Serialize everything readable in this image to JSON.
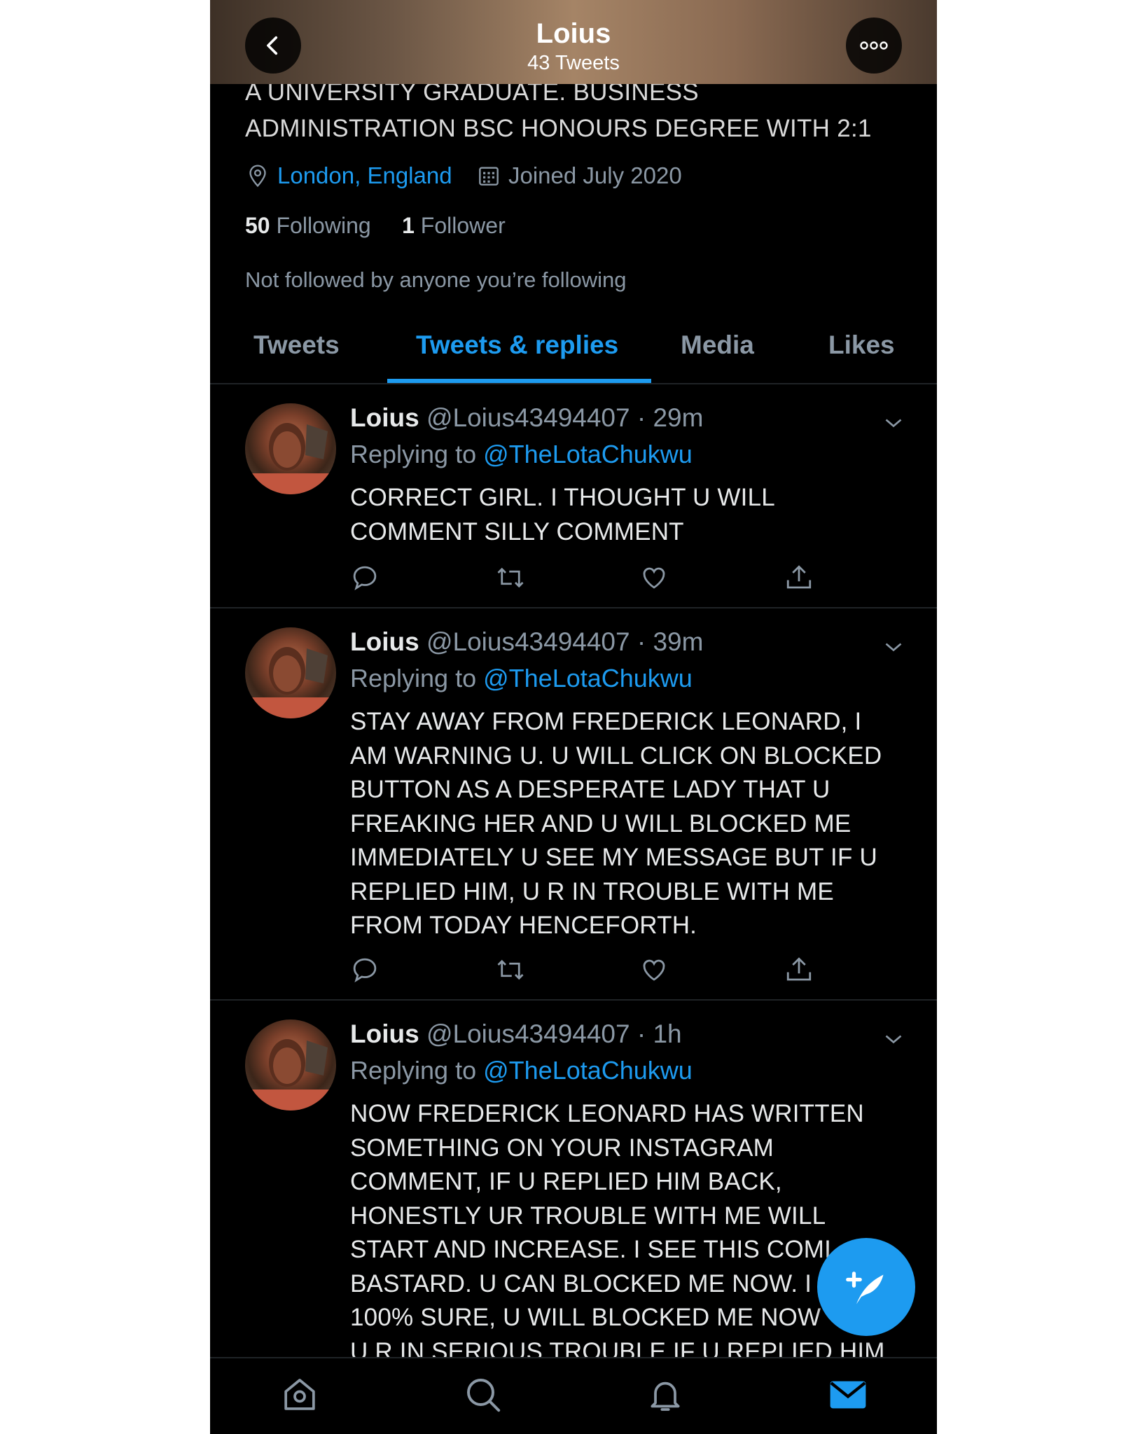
{
  "header": {
    "name": "Loius",
    "tweet_count": "43 Tweets"
  },
  "bio": {
    "line1": "A UNIVERSITY GRADUATE. BUSINESS",
    "line2": "ADMINISTRATION BSC HONOURS DEGREE WITH 2:1"
  },
  "meta": {
    "location": "London, England",
    "joined": "Joined July 2020"
  },
  "stats": {
    "following_count": "50",
    "following_label": "Following",
    "followers_count": "1",
    "followers_label": "Follower"
  },
  "not_followed": "Not followed by anyone you’re following",
  "tabs": [
    "Tweets",
    "Tweets & replies",
    "Media",
    "Likes"
  ],
  "tweets": [
    {
      "name": "Loius",
      "handle": "@Loius43494407",
      "time": "· 29m",
      "replying_label": "Replying to",
      "replying_to": "@TheLotaChukwu",
      "text": "CORRECT GIRL. I THOUGHT U WILL\nCOMMENT SILLY COMMENT"
    },
    {
      "name": "Loius",
      "handle": "@Loius43494407",
      "time": "· 39m",
      "replying_label": "Replying to",
      "replying_to": "@TheLotaChukwu",
      "text": "STAY AWAY FROM FREDERICK LEONARD, I\nAM WARNING U. U WILL CLICK ON BLOCKED\nBUTTON AS A DESPERATE LADY THAT U\nFREAKING HER AND U WILL BLOCKED ME\nIMMEDIATELY U SEE MY MESSAGE BUT IF U\nREPLIED HIM, U R IN TROUBLE WITH ME\nFROM TODAY HENCEFORTH."
    },
    {
      "name": "Loius",
      "handle": "@Loius43494407",
      "time": "· 1h",
      "replying_label": "Replying to",
      "replying_to": "@TheLotaChukwu",
      "text": "NOW FREDERICK LEONARD HAS WRITTEN\nSOMETHING ON YOUR INSTAGRAM\nCOMMENT, IF U REPLIED HIM BACK,\nHONESTLY UR TROUBLE WITH ME WILL\nSTART AND INCREASE. I SEE THIS COMI\nBASTARD. U CAN BLOCKED ME NOW. I\n100% SURE, U WILL BLOCKED ME NOW\nU R IN SERIOUS TROUBLE IF U REPLIED HIM."
    }
  ],
  "colors": {
    "accent": "#1d9bf0",
    "background": "#000000",
    "muted": "#8b98a5",
    "text": "#e7e9ea"
  },
  "icons": [
    "back-arrow-icon",
    "more-icon",
    "location-pin-icon",
    "calendar-icon",
    "chevron-down-icon",
    "reply-icon",
    "retweet-icon",
    "like-icon",
    "share-icon",
    "compose-icon",
    "home-icon",
    "search-icon",
    "notifications-icon",
    "messages-icon"
  ]
}
